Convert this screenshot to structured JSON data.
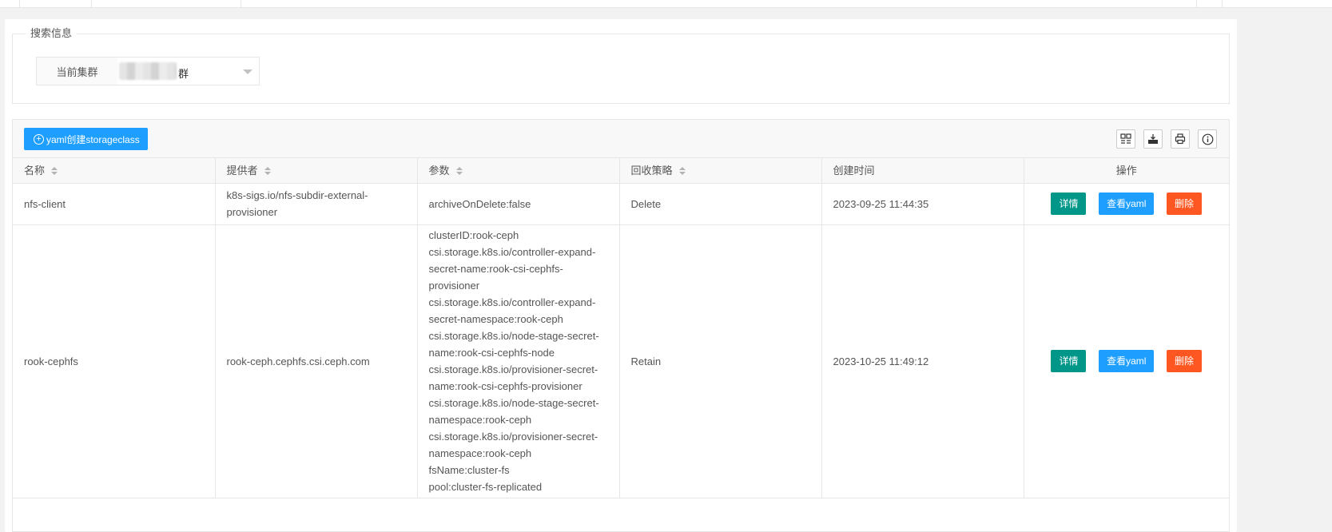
{
  "search": {
    "legend": "搜索信息",
    "cluster_label": "当前集群",
    "cluster_value": "群"
  },
  "toolbar": {
    "create_label": "yaml创建storageclass",
    "icons": [
      "columns-icon",
      "export-icon",
      "print-icon",
      "info-icon"
    ]
  },
  "table": {
    "columns": [
      {
        "label": "名称",
        "sortable": true
      },
      {
        "label": "提供者",
        "sortable": true
      },
      {
        "label": "参数",
        "sortable": true
      },
      {
        "label": "回收策略",
        "sortable": true
      },
      {
        "label": "创建时间",
        "sortable": false
      },
      {
        "label": "操作",
        "sortable": false
      }
    ],
    "rows": [
      {
        "name": "nfs-client",
        "provisioner": "k8s-sigs.io/nfs-subdir-external-provisioner",
        "params": [
          "archiveOnDelete:false"
        ],
        "reclaim": "Delete",
        "created": "2023-09-25 11:44:35"
      },
      {
        "name": "rook-cephfs",
        "provisioner": "rook-ceph.cephfs.csi.ceph.com",
        "params": [
          "clusterID:rook-ceph",
          "csi.storage.k8s.io/controller-expand-secret-name:rook-csi-cephfs-provisioner",
          "csi.storage.k8s.io/controller-expand-secret-namespace:rook-ceph",
          "csi.storage.k8s.io/node-stage-secret-name:rook-csi-cephfs-node",
          "csi.storage.k8s.io/provisioner-secret-name:rook-csi-cephfs-provisioner",
          "csi.storage.k8s.io/node-stage-secret-namespace:rook-ceph",
          "csi.storage.k8s.io/provisioner-secret-namespace:rook-ceph",
          "fsName:cluster-fs",
          "pool:cluster-fs-replicated"
        ],
        "reclaim": "Retain",
        "created": "2023-10-25 11:49:12"
      }
    ],
    "actions": {
      "detail": "详情",
      "yaml": "查看yaml",
      "delete": "删除"
    }
  },
  "colors": {
    "primary": "#1e9fff",
    "detail": "#009688",
    "danger": "#ff5722"
  }
}
